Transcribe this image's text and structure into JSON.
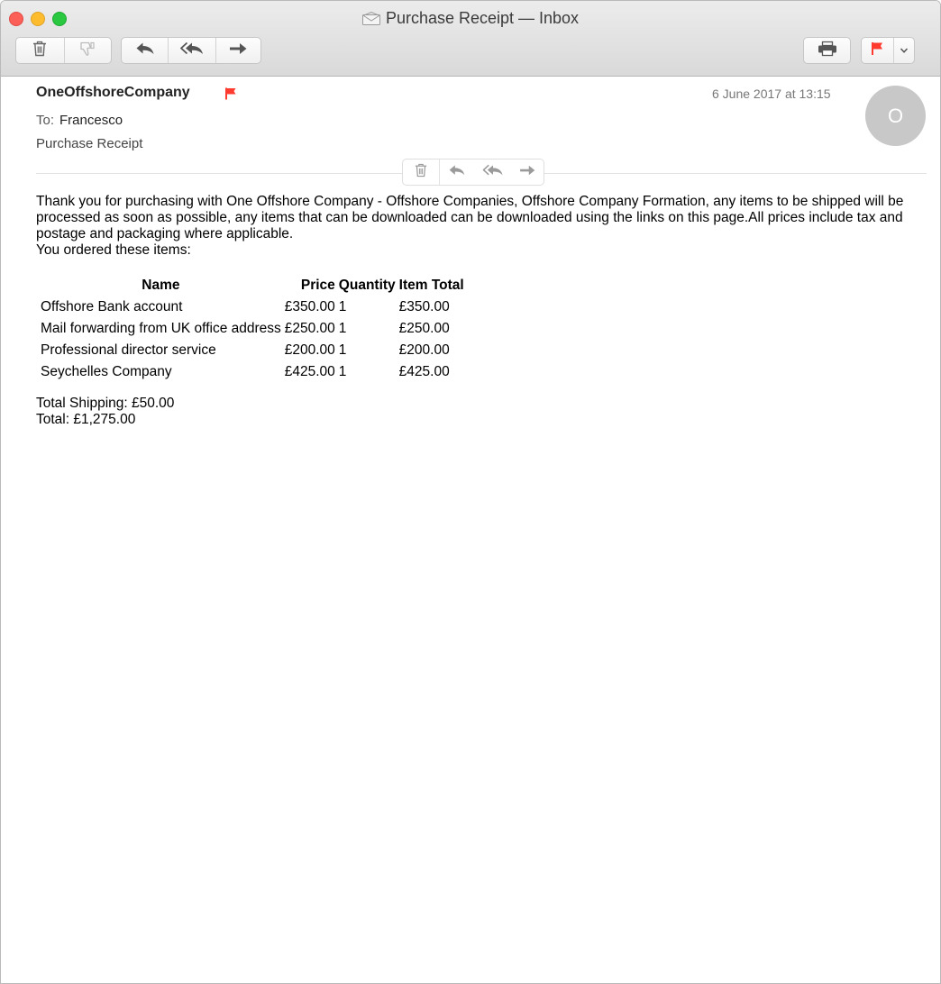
{
  "window": {
    "title": "Purchase Receipt — Inbox"
  },
  "toolbar": {
    "icons": [
      "trash-icon",
      "junk-icon",
      "reply-icon",
      "reply-all-icon",
      "forward-icon",
      "print-icon",
      "flag-icon",
      "chevron-down-icon"
    ],
    "flag_color": "#ff3b30"
  },
  "message": {
    "from": "OneOffshoreCompany",
    "date": "6 June 2017 at 13:15",
    "to_label": "To:",
    "to": "Francesco",
    "subject": "Purchase Receipt",
    "avatar_initial": "O",
    "avatar_color": "#c8c8c8",
    "flagged": true
  },
  "body": {
    "intro": "Thank you for purchasing with One Offshore Company - Offshore Companies, Offshore Company Formation, any items to be shipped will be processed as soon as possible, any items that can be downloaded can be downloaded using the links on this page.All prices include tax and postage and packaging where applicable.",
    "ordered": "You ordered these items:",
    "table": {
      "headers": [
        "Name",
        "Price",
        "Quantity",
        "Item Total"
      ],
      "rows": [
        [
          "Offshore Bank account",
          "£350.00",
          "1",
          "£350.00"
        ],
        [
          "Mail forwarding from UK office address",
          "£250.00",
          "1",
          "£250.00"
        ],
        [
          "Professional director service",
          "£200.00",
          "1",
          "£200.00"
        ],
        [
          "Seychelles Company",
          "£425.00",
          "1",
          "£425.00"
        ]
      ]
    },
    "shipping": "Total Shipping: £50.00",
    "total": "Total: £1,275.00"
  }
}
